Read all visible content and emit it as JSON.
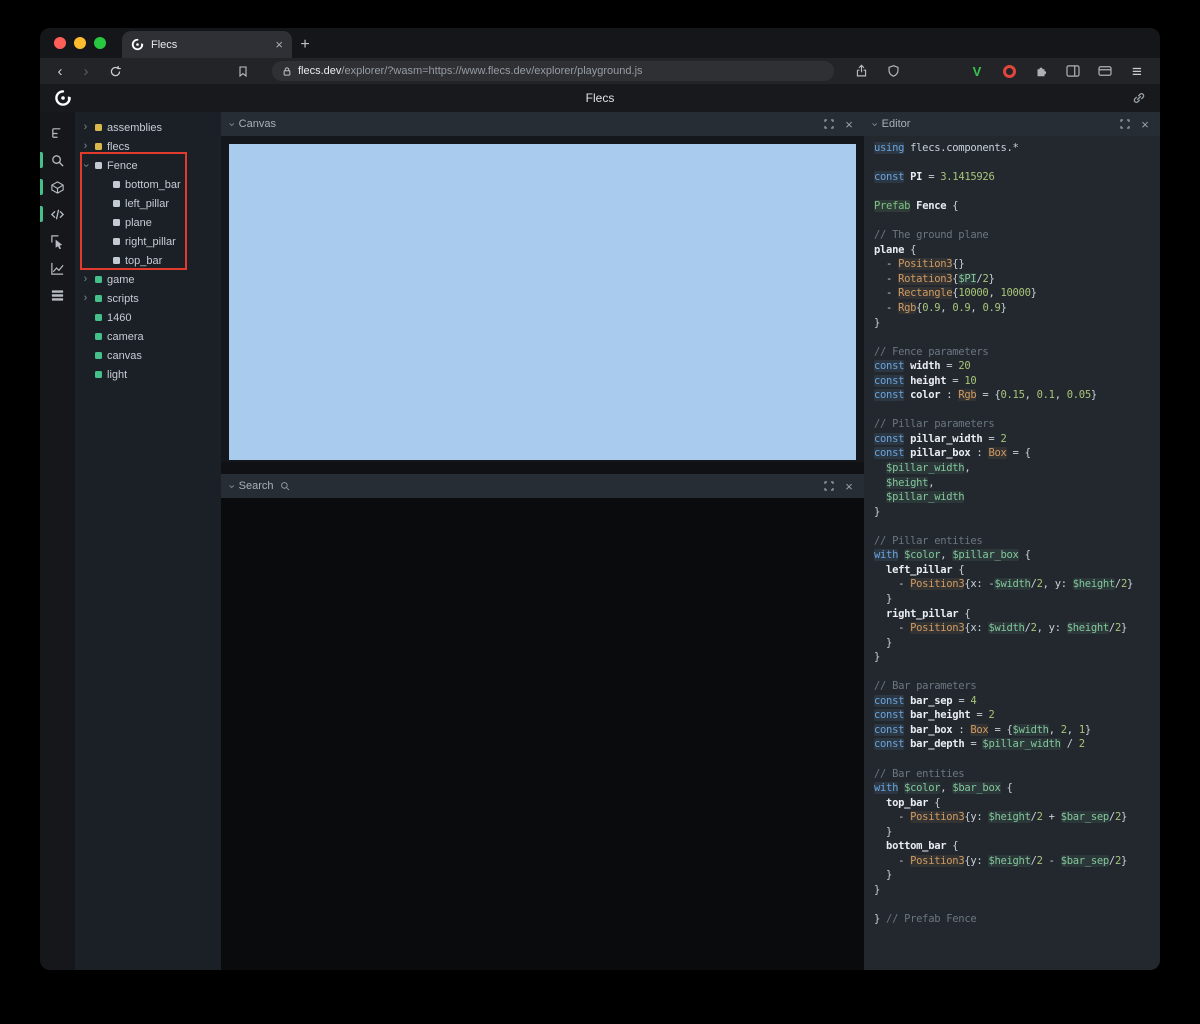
{
  "icons": {
    "chevron_right": "›",
    "back": "‹",
    "forward": "›",
    "close": "×",
    "new_tab": "+",
    "menu": "≡",
    "v_logo": "V"
  },
  "browser": {
    "tab_title": "Flecs",
    "url_domain": "flecs.dev",
    "url_path": "/explorer/?wasm=https://www.flecs.dev/explorer/playground.js"
  },
  "app": {
    "title": "Flecs"
  },
  "panels": {
    "canvas": "Canvas",
    "search": "Search",
    "editor": "Editor"
  },
  "sidebar_icons": [
    {
      "name": "entity-tree",
      "active": false
    },
    {
      "name": "search",
      "active": true
    },
    {
      "name": "scene",
      "active": true
    },
    {
      "name": "code",
      "active": true
    },
    {
      "name": "inspector",
      "active": false
    },
    {
      "name": "statistics",
      "active": false
    },
    {
      "name": "tables",
      "active": false
    }
  ],
  "tree": {
    "items": [
      {
        "label": "assemblies",
        "depth": 0,
        "arrow": "collapsed",
        "dot": "yellow"
      },
      {
        "label": "flecs",
        "depth": 0,
        "arrow": "collapsed",
        "dot": "yellow"
      },
      {
        "label": "Fence",
        "depth": 0,
        "arrow": "expanded",
        "dot": "gray"
      },
      {
        "label": "bottom_bar",
        "depth": 1,
        "arrow": "none",
        "dot": "gray"
      },
      {
        "label": "left_pillar",
        "depth": 1,
        "arrow": "none",
        "dot": "gray"
      },
      {
        "label": "plane",
        "depth": 1,
        "arrow": "none",
        "dot": "gray"
      },
      {
        "label": "right_pillar",
        "depth": 1,
        "arrow": "none",
        "dot": "gray"
      },
      {
        "label": "top_bar",
        "depth": 1,
        "arrow": "none",
        "dot": "gray"
      },
      {
        "label": "game",
        "depth": 0,
        "arrow": "collapsed",
        "dot": "green"
      },
      {
        "label": "scripts",
        "depth": 0,
        "arrow": "collapsed",
        "dot": "green"
      },
      {
        "label": "1460",
        "depth": 0,
        "arrow": "none",
        "dot": "green"
      },
      {
        "label": "camera",
        "depth": 0,
        "arrow": "none",
        "dot": "green"
      },
      {
        "label": "canvas",
        "depth": 0,
        "arrow": "none",
        "dot": "green"
      },
      {
        "label": "light",
        "depth": 0,
        "arrow": "none",
        "dot": "green"
      }
    ]
  },
  "editor": {
    "code_lines": [
      [
        [
          "kw",
          "using"
        ],
        [
          "pl",
          " flecs.components.*"
        ]
      ],
      [],
      [
        [
          "kw",
          "const"
        ],
        [
          "pl",
          " "
        ],
        [
          "ent",
          "PI"
        ],
        [
          "pl",
          " = "
        ],
        [
          "num",
          "3.1415926"
        ]
      ],
      [],
      [
        [
          "prefab",
          "Prefab"
        ],
        [
          "pl",
          " "
        ],
        [
          "ent",
          "Fence"
        ],
        [
          "pl",
          " {"
        ]
      ],
      [],
      [
        [
          "cm",
          "// The ground plane"
        ]
      ],
      [
        [
          "ent",
          "plane"
        ],
        [
          "pl",
          " {"
        ]
      ],
      [
        [
          "pl",
          "  - "
        ],
        [
          "type",
          "Position3"
        ],
        [
          "pl",
          "{}"
        ]
      ],
      [
        [
          "pl",
          "  - "
        ],
        [
          "type",
          "Rotation3"
        ],
        [
          "pl",
          "{"
        ],
        [
          "var",
          "$PI"
        ],
        [
          "pl",
          "/"
        ],
        [
          "num",
          "2"
        ],
        [
          "pl",
          "}"
        ]
      ],
      [
        [
          "pl",
          "  - "
        ],
        [
          "type",
          "Rectangle"
        ],
        [
          "pl",
          "{"
        ],
        [
          "num",
          "10000"
        ],
        [
          "pl",
          ", "
        ],
        [
          "num",
          "10000"
        ],
        [
          "pl",
          "}"
        ]
      ],
      [
        [
          "pl",
          "  - "
        ],
        [
          "type",
          "Rgb"
        ],
        [
          "pl",
          "{"
        ],
        [
          "num",
          "0.9"
        ],
        [
          "pl",
          ", "
        ],
        [
          "num",
          "0.9"
        ],
        [
          "pl",
          ", "
        ],
        [
          "num",
          "0.9"
        ],
        [
          "pl",
          "}"
        ]
      ],
      [
        [
          "pl",
          "}"
        ]
      ],
      [],
      [
        [
          "cm",
          "// Fence parameters"
        ]
      ],
      [
        [
          "kw",
          "const"
        ],
        [
          "pl",
          " "
        ],
        [
          "ent",
          "width"
        ],
        [
          "pl",
          " = "
        ],
        [
          "num",
          "20"
        ]
      ],
      [
        [
          "kw",
          "const"
        ],
        [
          "pl",
          " "
        ],
        [
          "ent",
          "height"
        ],
        [
          "pl",
          " = "
        ],
        [
          "num",
          "10"
        ]
      ],
      [
        [
          "kw",
          "const"
        ],
        [
          "pl",
          " "
        ],
        [
          "ent",
          "color"
        ],
        [
          "pl",
          " : "
        ],
        [
          "type",
          "Rgb"
        ],
        [
          "pl",
          " = {"
        ],
        [
          "num",
          "0.15"
        ],
        [
          "pl",
          ", "
        ],
        [
          "num",
          "0.1"
        ],
        [
          "pl",
          ", "
        ],
        [
          "num",
          "0.05"
        ],
        [
          "pl",
          "}"
        ]
      ],
      [],
      [
        [
          "cm",
          "// Pillar parameters"
        ]
      ],
      [
        [
          "kw",
          "const"
        ],
        [
          "pl",
          " "
        ],
        [
          "ent",
          "pillar_width"
        ],
        [
          "pl",
          " = "
        ],
        [
          "num",
          "2"
        ]
      ],
      [
        [
          "kw",
          "const"
        ],
        [
          "pl",
          " "
        ],
        [
          "ent",
          "pillar_box"
        ],
        [
          "pl",
          " : "
        ],
        [
          "type",
          "Box"
        ],
        [
          "pl",
          " = {"
        ]
      ],
      [
        [
          "pl",
          "  "
        ],
        [
          "var",
          "$pillar_width"
        ],
        [
          "pl",
          ","
        ]
      ],
      [
        [
          "pl",
          "  "
        ],
        [
          "var",
          "$height"
        ],
        [
          "pl",
          ","
        ]
      ],
      [
        [
          "pl",
          "  "
        ],
        [
          "var",
          "$pillar_width"
        ]
      ],
      [
        [
          "pl",
          "}"
        ]
      ],
      [],
      [
        [
          "cm",
          "// Pillar entities"
        ]
      ],
      [
        [
          "kw",
          "with"
        ],
        [
          "pl",
          " "
        ],
        [
          "var",
          "$color"
        ],
        [
          "pl",
          ", "
        ],
        [
          "var",
          "$pillar_box"
        ],
        [
          "pl",
          " {"
        ]
      ],
      [
        [
          "pl",
          "  "
        ],
        [
          "ent",
          "left_pillar"
        ],
        [
          "pl",
          " {"
        ]
      ],
      [
        [
          "pl",
          "    - "
        ],
        [
          "type",
          "Position3"
        ],
        [
          "pl",
          "{x: -"
        ],
        [
          "var",
          "$width"
        ],
        [
          "pl",
          "/"
        ],
        [
          "num",
          "2"
        ],
        [
          "pl",
          ", y: "
        ],
        [
          "var",
          "$height"
        ],
        [
          "pl",
          "/"
        ],
        [
          "num",
          "2"
        ],
        [
          "pl",
          "}"
        ]
      ],
      [
        [
          "pl",
          "  }"
        ]
      ],
      [
        [
          "pl",
          "  "
        ],
        [
          "ent",
          "right_pillar"
        ],
        [
          "pl",
          " {"
        ]
      ],
      [
        [
          "pl",
          "    - "
        ],
        [
          "type",
          "Position3"
        ],
        [
          "pl",
          "{x: "
        ],
        [
          "var",
          "$width"
        ],
        [
          "pl",
          "/"
        ],
        [
          "num",
          "2"
        ],
        [
          "pl",
          ", y: "
        ],
        [
          "var",
          "$height"
        ],
        [
          "pl",
          "/"
        ],
        [
          "num",
          "2"
        ],
        [
          "pl",
          "}"
        ]
      ],
      [
        [
          "pl",
          "  }"
        ]
      ],
      [
        [
          "pl",
          "}"
        ]
      ],
      [],
      [
        [
          "cm",
          "// Bar parameters"
        ]
      ],
      [
        [
          "kw",
          "const"
        ],
        [
          "pl",
          " "
        ],
        [
          "ent",
          "bar_sep"
        ],
        [
          "pl",
          " = "
        ],
        [
          "num",
          "4"
        ]
      ],
      [
        [
          "kw",
          "const"
        ],
        [
          "pl",
          " "
        ],
        [
          "ent",
          "bar_height"
        ],
        [
          "pl",
          " = "
        ],
        [
          "num",
          "2"
        ]
      ],
      [
        [
          "kw",
          "const"
        ],
        [
          "pl",
          " "
        ],
        [
          "ent",
          "bar_box"
        ],
        [
          "pl",
          " : "
        ],
        [
          "type",
          "Box"
        ],
        [
          "pl",
          " = {"
        ],
        [
          "var",
          "$width"
        ],
        [
          "pl",
          ", "
        ],
        [
          "num",
          "2"
        ],
        [
          "pl",
          ", "
        ],
        [
          "num",
          "1"
        ],
        [
          "pl",
          "}"
        ]
      ],
      [
        [
          "kw",
          "const"
        ],
        [
          "pl",
          " "
        ],
        [
          "ent",
          "bar_depth"
        ],
        [
          "pl",
          " = "
        ],
        [
          "var",
          "$pillar_width"
        ],
        [
          "pl",
          " / "
        ],
        [
          "num",
          "2"
        ]
      ],
      [],
      [
        [
          "cm",
          "// Bar entities"
        ]
      ],
      [
        [
          "kw",
          "with"
        ],
        [
          "pl",
          " "
        ],
        [
          "var",
          "$color"
        ],
        [
          "pl",
          ", "
        ],
        [
          "var",
          "$bar_box"
        ],
        [
          "pl",
          " {"
        ]
      ],
      [
        [
          "pl",
          "  "
        ],
        [
          "ent",
          "top_bar"
        ],
        [
          "pl",
          " {"
        ]
      ],
      [
        [
          "pl",
          "    - "
        ],
        [
          "type",
          "Position3"
        ],
        [
          "pl",
          "{y: "
        ],
        [
          "var",
          "$height"
        ],
        [
          "pl",
          "/"
        ],
        [
          "num",
          "2"
        ],
        [
          "pl",
          " + "
        ],
        [
          "var",
          "$bar_sep"
        ],
        [
          "pl",
          "/"
        ],
        [
          "num",
          "2"
        ],
        [
          "pl",
          "}"
        ]
      ],
      [
        [
          "pl",
          "  }"
        ]
      ],
      [
        [
          "pl",
          "  "
        ],
        [
          "ent",
          "bottom_bar"
        ],
        [
          "pl",
          " {"
        ]
      ],
      [
        [
          "pl",
          "    - "
        ],
        [
          "type",
          "Position3"
        ],
        [
          "pl",
          "{y: "
        ],
        [
          "var",
          "$height"
        ],
        [
          "pl",
          "/"
        ],
        [
          "num",
          "2"
        ],
        [
          "pl",
          " - "
        ],
        [
          "var",
          "$bar_sep"
        ],
        [
          "pl",
          "/"
        ],
        [
          "num",
          "2"
        ],
        [
          "pl",
          "}"
        ]
      ],
      [
        [
          "pl",
          "  }"
        ]
      ],
      [
        [
          "pl",
          "}"
        ]
      ],
      [],
      [
        [
          "pl",
          "} "
        ],
        [
          "cm",
          "// Prefab Fence"
        ]
      ]
    ]
  },
  "colors": {
    "canvas_sky": "#a9cbee",
    "accent_green": "#45c08a",
    "annotation_red": "#e23b2e",
    "tree_yellow": "#d9b84d"
  }
}
